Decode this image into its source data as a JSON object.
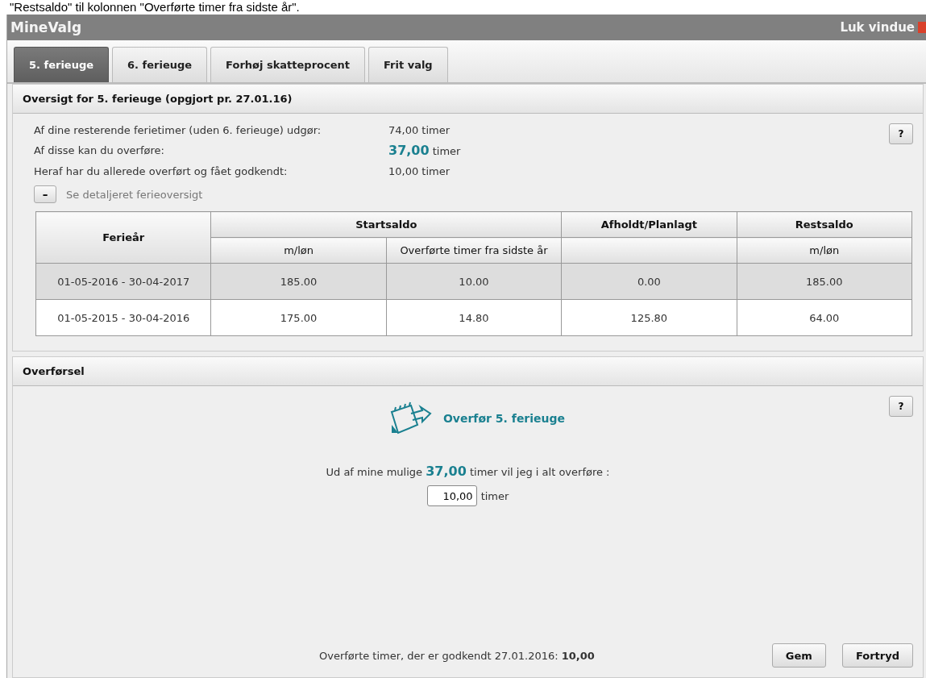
{
  "caption": "\"Restsaldo\" til kolonnen \"Overførte timer fra sidste år\".",
  "window": {
    "title": "MineValg",
    "close_label": "Luk vindue"
  },
  "tabs": [
    {
      "label": "5. ferieuge",
      "selected": true
    },
    {
      "label": "6. ferieuge",
      "selected": false
    },
    {
      "label": "Forhøj skatteprocent",
      "selected": false
    },
    {
      "label": "Frit valg",
      "selected": false
    }
  ],
  "overview": {
    "title": "Oversigt for 5. ferieuge (opgjort pr. 27.01.16)",
    "help": "?",
    "summary": [
      {
        "label": "Af dine resterende ferietimer (uden 6. ferieuge) udgør:",
        "value": "74,00 timer"
      },
      {
        "label": "Af disse kan du overføre:",
        "value": "**37,00** timer"
      },
      {
        "label": "Heraf har du allerede overført og fået godkendt:",
        "value": "10,00 timer"
      }
    ],
    "toggle": {
      "symbol": "–",
      "label": "Se detaljeret ferieoversigt"
    },
    "table": {
      "header_rows": [
        [
          {
            "kind": "label",
            "text": "Ferieår",
            "rowspan": 2
          },
          {
            "kind": "label",
            "text": "Startsaldo",
            "colspan": 2
          },
          {
            "kind": "label",
            "text": "Afholdt/Planlagt"
          },
          {
            "kind": "label",
            "text": "Restsaldo"
          }
        ],
        [
          {
            "kind": "label",
            "text": "m/løn"
          },
          {
            "kind": "label",
            "text": "Overførte timer fra sidste år"
          },
          {
            "kind": "blank"
          },
          {
            "kind": "label",
            "text": "m/løn"
          }
        ]
      ],
      "rows": [
        {
          "selected": true,
          "cells": [
            "01-05-2016 - 30-04-2017",
            "185.00",
            "10.00",
            "0.00",
            "185.00"
          ]
        },
        {
          "selected": false,
          "cells": [
            "01-05-2015 - 30-04-2016",
            "175.00",
            "14.80",
            "125.80",
            "64.00"
          ]
        }
      ]
    }
  },
  "transfer": {
    "title": "Overførsel",
    "help": "?",
    "heading": "Overfør 5. ferieuge",
    "prompt": "Ud af mine mulige **37,00** timer vil jeg i alt overføre :",
    "input_value": "10,00",
    "input_unit": "timer",
    "approved": "Overførte timer, der er godkendt 27.01.2016: **10,00**",
    "buttons": [
      "Gem",
      "Fortryd"
    ]
  }
}
